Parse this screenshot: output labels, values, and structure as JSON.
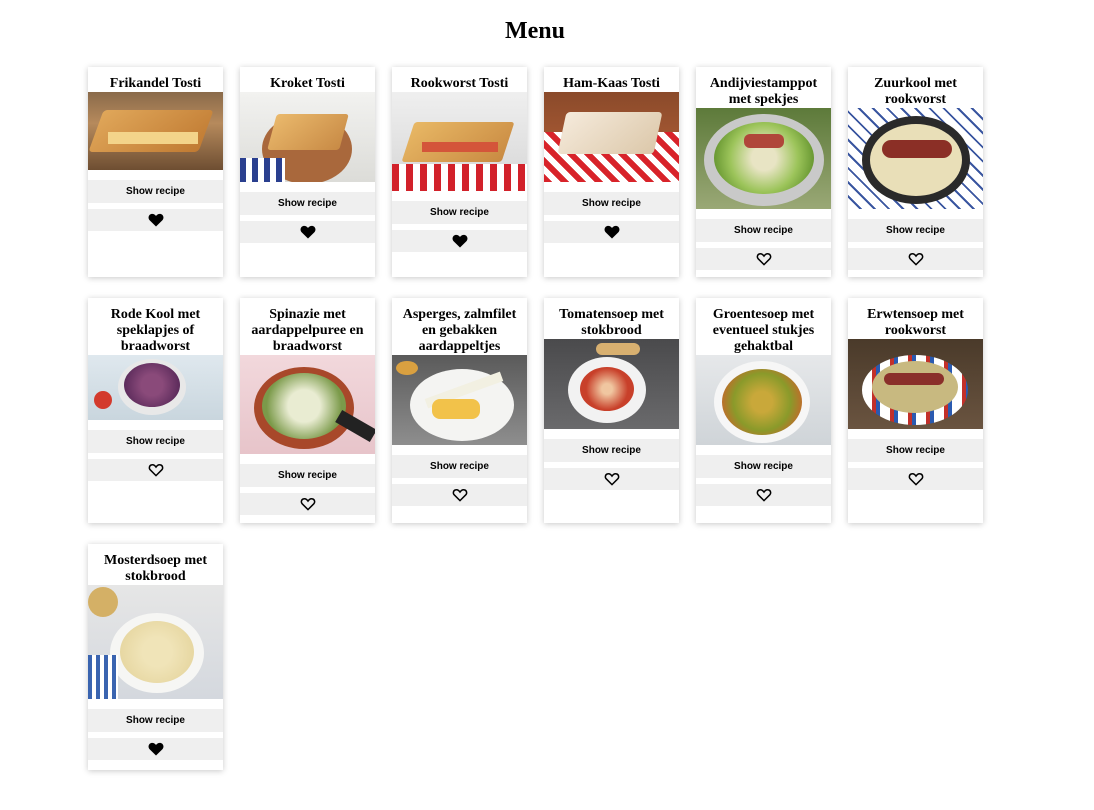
{
  "page": {
    "title": "Menu"
  },
  "labels": {
    "show_recipe": "Show recipe"
  },
  "recipes": [
    {
      "title": "Frikandel Tosti",
      "favorite": true
    },
    {
      "title": "Kroket Tosti",
      "favorite": true
    },
    {
      "title": "Rookworst Tosti",
      "favorite": true
    },
    {
      "title": "Ham-Kaas Tosti",
      "favorite": true
    },
    {
      "title": "Andijviestamppot met spekjes",
      "favorite": false
    },
    {
      "title": "Zuurkool met rookworst",
      "favorite": false
    },
    {
      "title": "Rode Kool met speklapjes of braadworst",
      "favorite": false
    },
    {
      "title": "Spinazie met aardappelpuree en braadworst",
      "favorite": false
    },
    {
      "title": "Asperges, zalmfilet en gebakken aardappeltjes",
      "favorite": false
    },
    {
      "title": "Tomatensoep met stokbrood",
      "favorite": false
    },
    {
      "title": "Groentesoep met eventueel stukjes gehaktbal",
      "favorite": false
    },
    {
      "title": "Erwtensoep met rookworst",
      "favorite": false
    },
    {
      "title": "Mosterdsoep met stokbrood",
      "favorite": true
    }
  ],
  "icons": {
    "favorite": "heart-icon"
  },
  "colors": {
    "button_bg": "#efefef",
    "heart": "#000000"
  }
}
